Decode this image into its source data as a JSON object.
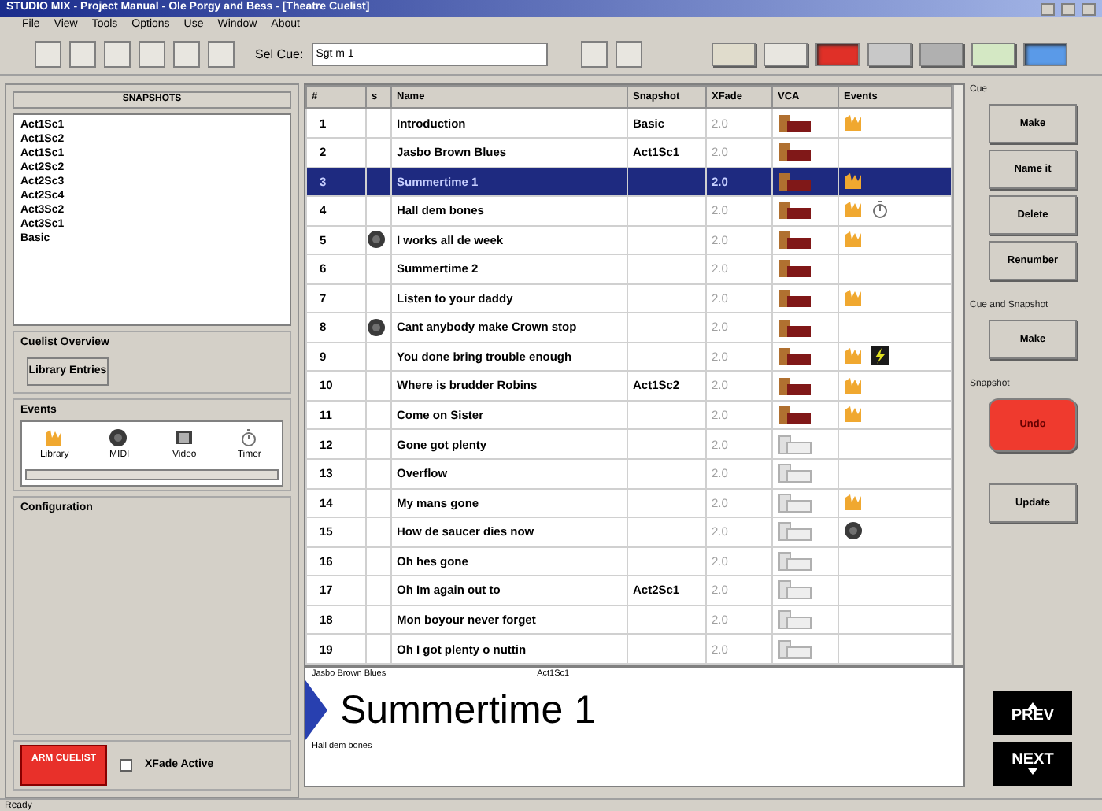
{
  "window": {
    "title": "STUDIO MIX - Project Manual - Ole Porgy and Bess - [Theatre Cuelist]"
  },
  "menu": [
    "File",
    "View",
    "Tools",
    "Options",
    "Use",
    "Window",
    "About"
  ],
  "toolbar": {
    "cue_label": "Sel Cue:",
    "cue_value": "Sgt m 1",
    "toggles": [
      {
        "color": "#e0dccc",
        "on": false
      },
      {
        "color": "#e8e6e0",
        "on": false
      },
      {
        "color": "#e03028",
        "on": true
      },
      {
        "color": "#c8c8c8",
        "on": false
      },
      {
        "color": "#b0b0b0",
        "on": false
      },
      {
        "color": "#d4e8c4",
        "on": false
      },
      {
        "color": "#5a9ae8",
        "on": true
      }
    ]
  },
  "snapshots": {
    "header": "SNAPSHOTS",
    "items": [
      "Act1Sc1",
      "Act1Sc2",
      "Act1Sc1",
      "Act2Sc2",
      "Act2Sc3",
      "Act2Sc4",
      "Act3Sc2",
      "Act3Sc1",
      "Basic"
    ]
  },
  "cuelist_overview": {
    "title": "Cuelist Overview",
    "button": "Library Entries"
  },
  "events_panel": {
    "title": "Events",
    "items": [
      {
        "label": "Library",
        "kind": "library"
      },
      {
        "label": "MIDI",
        "kind": "midi"
      },
      {
        "label": "Video",
        "kind": "video"
      },
      {
        "label": "Timer",
        "kind": "timer"
      }
    ]
  },
  "configuration": {
    "title": "Configuration"
  },
  "arm_button": "ARM CUELIST",
  "xfade": {
    "label": "XFade Active",
    "checked": false
  },
  "table": {
    "columns": [
      "#",
      "s",
      "Name",
      "Snapshot",
      "XFade",
      "VCA",
      "Events"
    ],
    "rows": [
      {
        "number": "1",
        "name": "Introduction",
        "snapshot": "Basic",
        "xfade": "2.0",
        "selected": false,
        "midi_marker": false,
        "vca_active": true,
        "events": [
          {
            "kind": "library"
          }
        ]
      },
      {
        "number": "2",
        "name": "Jasbo Brown Blues",
        "snapshot": "Act1Sc1",
        "xfade": "2.0",
        "selected": false,
        "midi_marker": false,
        "vca_active": true
      },
      {
        "number": "3",
        "name": "Summertime 1",
        "xfade": "2.0",
        "selected": true,
        "midi_marker": false,
        "vca_active": true,
        "events": [
          {
            "kind": "library"
          }
        ]
      },
      {
        "number": "4",
        "name": "Hall dem bones",
        "xfade": "2.0",
        "selected": false,
        "midi_marker": false,
        "vca_active": true,
        "events": [
          {
            "kind": "library"
          },
          {
            "kind": "timer"
          }
        ]
      },
      {
        "number": "5",
        "name": "I works all de week",
        "xfade": "2.0",
        "selected": false,
        "midi_marker": true,
        "vca_active": true,
        "events": [
          {
            "kind": "library"
          }
        ]
      },
      {
        "number": "6",
        "name": "Summertime 2",
        "xfade": "2.0",
        "selected": false,
        "midi_marker": false,
        "vca_active": true
      },
      {
        "number": "7",
        "name": "Listen to your daddy",
        "xfade": "2.0",
        "selected": false,
        "midi_marker": false,
        "vca_active": true,
        "events": [
          {
            "kind": "library"
          }
        ]
      },
      {
        "number": "8",
        "name": "Cant anybody make Crown stop",
        "xfade": "2.0",
        "selected": false,
        "midi_marker": true,
        "vca_active": true
      },
      {
        "number": "9",
        "name": "You done bring trouble enough",
        "xfade": "2.0",
        "selected": false,
        "midi_marker": false,
        "vca_active": true,
        "events": [
          {
            "kind": "library"
          },
          {
            "kind": "script"
          }
        ]
      },
      {
        "number": "10",
        "name": "Where is brudder Robins",
        "snapshot": "Act1Sc2",
        "xfade": "2.0",
        "selected": false,
        "midi_marker": false,
        "vca_active": true,
        "events": [
          {
            "kind": "library"
          }
        ]
      },
      {
        "number": "11",
        "name": "Come on Sister",
        "xfade": "2.0",
        "selected": false,
        "midi_marker": false,
        "vca_active": true,
        "events": [
          {
            "kind": "library"
          }
        ]
      },
      {
        "number": "12",
        "name": "Gone got plenty",
        "xfade": "2.0",
        "selected": false,
        "midi_marker": false,
        "vca_active": false
      },
      {
        "number": "13",
        "name": "Overflow",
        "xfade": "2.0",
        "selected": false,
        "midi_marker": false,
        "vca_active": false
      },
      {
        "number": "14",
        "name": "My mans gone",
        "xfade": "2.0",
        "selected": false,
        "midi_marker": false,
        "vca_active": false,
        "events": [
          {
            "kind": "library"
          }
        ]
      },
      {
        "number": "15",
        "name": "How de saucer dies now",
        "xfade": "2.0",
        "selected": false,
        "midi_marker": false,
        "vca_active": false,
        "events": [
          {
            "kind": "midi"
          }
        ]
      },
      {
        "number": "16",
        "name": "Oh hes gone",
        "xfade": "2.0",
        "selected": false,
        "midi_marker": false,
        "vca_active": false
      },
      {
        "number": "17",
        "name": "Oh Im again out to",
        "snapshot": "Act2Sc1",
        "xfade": "2.0",
        "selected": false,
        "midi_marker": false,
        "vca_active": false
      },
      {
        "number": "18",
        "name": "Mon boyour never forget",
        "xfade": "2.0",
        "selected": false,
        "midi_marker": false,
        "vca_active": false
      },
      {
        "number": "19",
        "name": "Oh I got plenty o nuttin",
        "xfade": "2.0",
        "selected": false,
        "midi_marker": false,
        "vca_active": false
      }
    ]
  },
  "now_playing": {
    "previous": "Jasbo Brown Blues",
    "snapshot": "Act1Sc1",
    "current": "Summertime 1",
    "next": "Hall dem bones"
  },
  "side_panel": [
    {
      "title": "Cue",
      "buttons": [
        {
          "label": "Make",
          "kind": "normal"
        },
        {
          "label": "Name it",
          "kind": "normal"
        },
        {
          "label": "Delete",
          "kind": "normal"
        },
        {
          "label": "Renumber",
          "kind": "normal"
        }
      ]
    },
    {
      "title": "Cue and Snapshot",
      "buttons": [
        {
          "label": "Make",
          "kind": "normal"
        }
      ]
    },
    {
      "title": "Snapshot",
      "buttons": [
        {
          "label": "Undo",
          "kind": "alert"
        },
        {
          "label": "Update",
          "kind": "normal"
        }
      ]
    }
  ],
  "nav": {
    "prev": "PREV",
    "next": "NEXT"
  },
  "status_bar": "Ready"
}
